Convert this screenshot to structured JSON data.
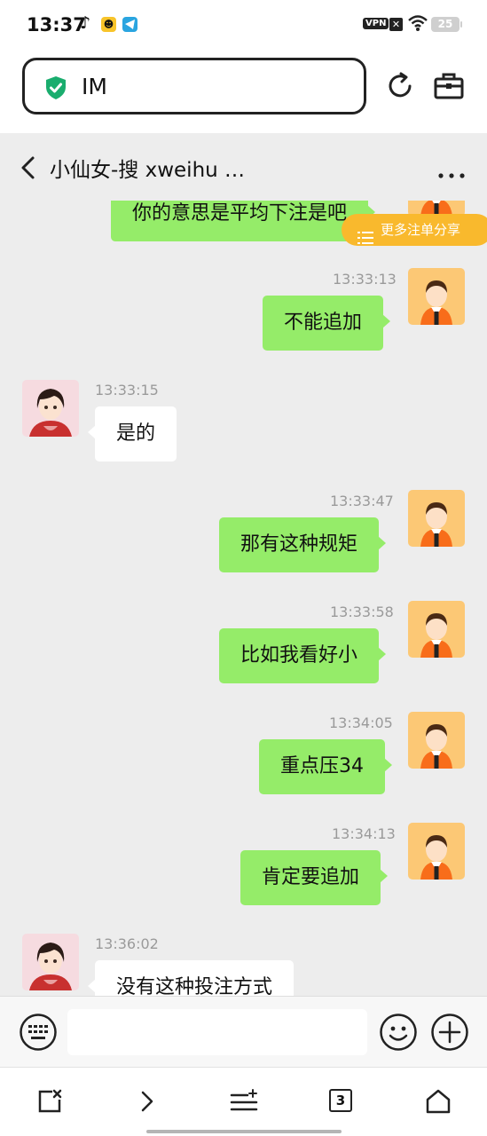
{
  "status_bar": {
    "time": "13:37",
    "vpn": "VPN",
    "battery": "25"
  },
  "browser": {
    "url": "IM"
  },
  "chat": {
    "title": "小仙女-搜 xweihu …"
  },
  "share_pill": {
    "label": "更多注单分享"
  },
  "messages": [
    {
      "side": "out",
      "time": "",
      "text": "你的意思是平均下注是吧"
    },
    {
      "side": "out",
      "time": "13:33:13",
      "text": "不能追加"
    },
    {
      "side": "in",
      "time": "13:33:15",
      "text": "是的"
    },
    {
      "side": "out",
      "time": "13:33:47",
      "text": "那有这种规矩"
    },
    {
      "side": "out",
      "time": "13:33:58",
      "text": "比如我看好小"
    },
    {
      "side": "out",
      "time": "13:34:05",
      "text": "重点压34"
    },
    {
      "side": "out",
      "time": "13:34:13",
      "text": "肯定要追加"
    },
    {
      "side": "in",
      "time": "13:36:02",
      "text": "没有这种投注方式"
    }
  ],
  "input": {
    "value": "",
    "placeholder": ""
  },
  "bottom_nav": {
    "tab_count": "3"
  },
  "colors": {
    "bubble_out": "#95ec69",
    "bubble_in": "#ffffff",
    "chat_bg": "#ededed",
    "share_pill": "#f9b92d",
    "shield": "#1aad6e"
  }
}
